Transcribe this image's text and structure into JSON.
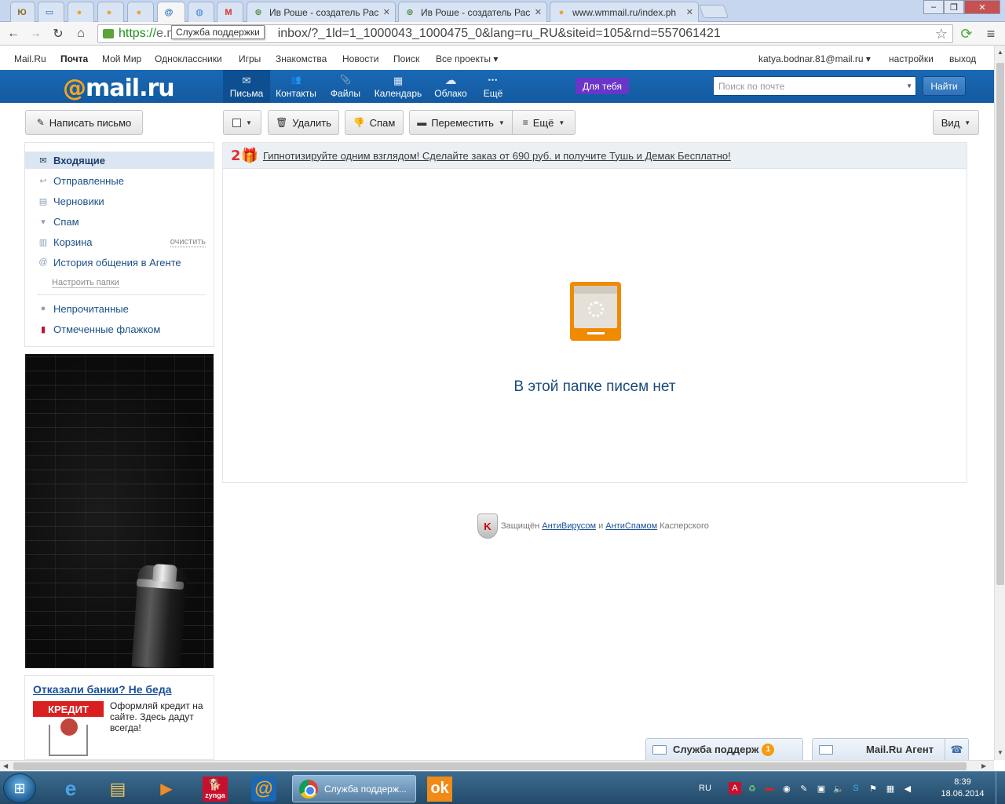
{
  "browser": {
    "tabs": [
      {
        "title": "",
        "icon": "yandex-money-icon"
      },
      {
        "title": "",
        "icon": "webmoney-icon"
      },
      {
        "title": "",
        "icon": "orange-ball-icon"
      },
      {
        "title": "",
        "icon": "orange-ball-icon"
      },
      {
        "title": "",
        "icon": "orange-ball-icon"
      },
      {
        "title": "",
        "icon": "mailru-at-icon",
        "active": true
      },
      {
        "title": "",
        "icon": "globe-icon"
      },
      {
        "title": "",
        "icon": "gmail-icon"
      },
      {
        "title": "Ив Роше - создатель Рас",
        "icon": "yves-rocher-icon"
      },
      {
        "title": "Ив Роше - создатель Рас",
        "icon": "yves-rocher-icon"
      },
      {
        "title": "www.wmmail.ru/index.ph",
        "icon": "orange-ball-icon"
      }
    ],
    "tab_close": "✕",
    "url_https": "https://",
    "url_host": "e.m",
    "url_path": "inbox/?_1ld=1_1000043_1000475_0&lang=ru_RU&siteid=105&rnd=557061421",
    "tooltip": "Служба поддержки"
  },
  "portal_nav": {
    "items": [
      "Mail.Ru",
      "Почта",
      "Мой Мир",
      "Одноклассники",
      "Игры",
      "Знакомства",
      "Новости",
      "Поиск",
      "Все проекты ▾"
    ],
    "user": "katya.bodnar.81@mail.ru ▾",
    "settings": "настройки",
    "logout": "выход"
  },
  "header": {
    "logo_at": "@",
    "logo_text": "mail.ru",
    "nav": [
      {
        "label": "Письма",
        "icon": "envelope-icon",
        "glyph": "✉",
        "active": true
      },
      {
        "label": "Контакты",
        "icon": "contacts-icon",
        "glyph": "👥"
      },
      {
        "label": "Файлы",
        "icon": "paperclip-icon",
        "glyph": "📎"
      },
      {
        "label": "Календарь",
        "icon": "calendar-icon",
        "glyph": "▦"
      },
      {
        "label": "Облако",
        "icon": "cloud-icon",
        "glyph": "☁"
      },
      {
        "label": "Ещё",
        "icon": "more-dots-icon",
        "glyph": "•••"
      }
    ],
    "for_you": "Для тебя",
    "search_placeholder": "Поиск по почте",
    "search_button": "Найти"
  },
  "actions": {
    "compose": "Написать письмо",
    "delete": "Удалить",
    "spam": "Спам",
    "move": "Переместить",
    "more": "Ещё",
    "view": "Вид"
  },
  "sidebar": {
    "folders": [
      {
        "label": "Входящие",
        "icon": "envelope-icon",
        "active": true
      },
      {
        "label": "Отправленные",
        "icon": "reply-arrow-icon"
      },
      {
        "label": "Черновики",
        "icon": "draft-page-icon"
      },
      {
        "label": "Спам",
        "icon": "thumbs-down-icon"
      },
      {
        "label": "Корзина",
        "icon": "trash-icon",
        "extra": "очистить"
      },
      {
        "label": "История общения в Агенте",
        "icon": "agent-at-icon"
      }
    ],
    "configure": "Настроить папки",
    "filters": [
      {
        "label": "Непрочитанные",
        "icon": "unread-dot-icon"
      },
      {
        "label": "Отмеченные флажком",
        "icon": "flag-icon"
      }
    ]
  },
  "ad2": {
    "title": "Отказали банки? Не беда",
    "image_label": "КРЕДИТ",
    "text": "Оформляй кредит на сайте. Здесь дадут всегда!"
  },
  "main": {
    "promo_badge": "2🎁",
    "promo_text": "Гипнотизируйте одним взглядом! Сделайте заказ от 690 руб. и получите Тушь и Демак Бесплатно!",
    "empty_message": "В этой папке писем нет"
  },
  "kaspersky": {
    "prefix": "Защищён",
    "antivirus": "АнтиВирусом",
    "and": "и",
    "antispam": "АнтиСпамом",
    "suffix": "Касперского"
  },
  "chat": {
    "support": "Служба поддерж",
    "support_badge": "1",
    "agent": "Mail.Ru Агент"
  },
  "taskbar": {
    "active_app": "Служба поддерж...",
    "lang": "RU",
    "time": "8:39",
    "date": "18.06.2014",
    "apps": [
      "ie-icon",
      "explorer-icon",
      "media-player-icon",
      "zynga-icon",
      "mailru-agent-icon",
      "chrome-icon",
      "odnoklassniki-icon"
    ],
    "zynga_label": "zynga"
  },
  "colors": {
    "header_blue": "#1a68b4",
    "logo_orange": "#f7a41d",
    "for_you_purple": "#6a35c9",
    "empty_text": "#1a4b7a"
  }
}
